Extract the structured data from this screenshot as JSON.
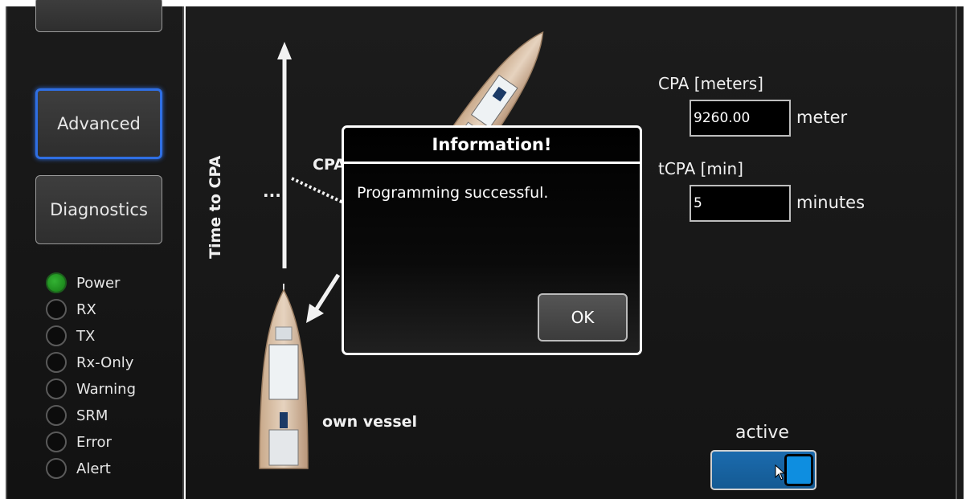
{
  "sidebar": {
    "buttons": [
      {
        "label": ""
      },
      {
        "label": "Advanced"
      },
      {
        "label": "Diagnostics"
      }
    ],
    "indicators": [
      {
        "label": "Power",
        "state": "on",
        "color": "#22a022"
      },
      {
        "label": "RX",
        "state": "off"
      },
      {
        "label": "TX",
        "state": "off"
      },
      {
        "label": "Rx-Only",
        "state": "off"
      },
      {
        "label": "Warning",
        "state": "off"
      },
      {
        "label": "SRM",
        "state": "off"
      },
      {
        "label": "Error",
        "state": "off"
      },
      {
        "label": "Alert",
        "state": "off"
      }
    ]
  },
  "diagram": {
    "time_to_cpa_label": "Time to CPA",
    "cpa_label": "CPA",
    "ellipsis": "...",
    "own_vessel_label": "own vessel"
  },
  "settings": {
    "cpa": {
      "label": "CPA [meters]",
      "value": "9260.00",
      "unit": "meter"
    },
    "tcpa": {
      "label": "tCPA [min]",
      "value": "5",
      "unit": "minutes"
    },
    "active": {
      "label": "active",
      "state": "on"
    }
  },
  "dialog": {
    "title": "Information!",
    "message": "Programming successful.",
    "ok_label": "OK"
  },
  "colors": {
    "accent_blue": "#2f6fe4",
    "toggle_blue": "#1b6bae",
    "led_green": "#22a022"
  }
}
